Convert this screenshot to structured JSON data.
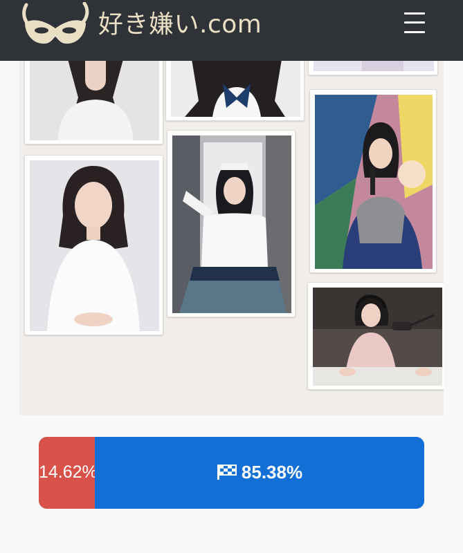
{
  "header": {
    "site_name": "好き嫌い.com",
    "logo_icon": "masquerade-mask-icon",
    "menu_icon": "hamburger-menu-icon",
    "background": "#2f3236",
    "logo_color": "#e9dfc5"
  },
  "gallery": {
    "photos": [
      {
        "subject": "girl in white sleeveless top (cropped)"
      },
      {
        "subject": "girl in school uniform with ribbon (cropped)"
      },
      {
        "subject": "partial photo (cropped)"
      },
      {
        "subject": "girl with microphone at event"
      },
      {
        "subject": "girl in white sleeveless top, portrait"
      },
      {
        "subject": "girl in white stage costume"
      },
      {
        "subject": "girl in recording studio with headphones"
      }
    ]
  },
  "vote": {
    "dislike_percent": "14.62%",
    "dislike_value": 14.62,
    "like_percent": "85.38%",
    "like_value": 85.38,
    "like_icon": "checkered-flag-icon",
    "dislike_color": "#d9524a",
    "like_color": "#126fd6"
  }
}
